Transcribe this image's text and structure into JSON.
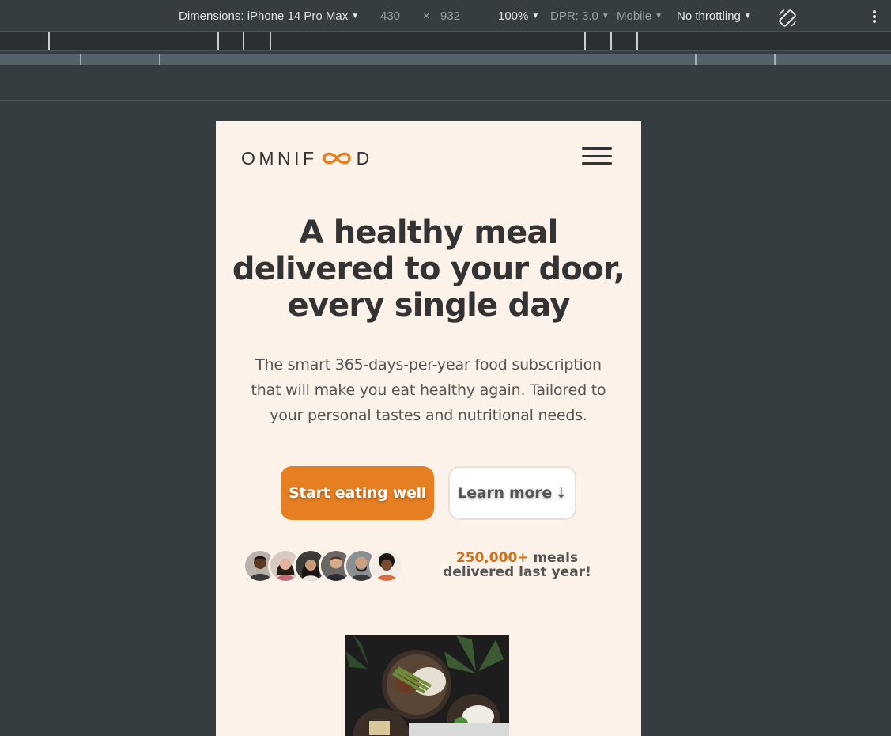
{
  "devtools": {
    "dimensions_label": "Dimensions: iPhone 14 Pro Max",
    "width": "430",
    "times": "×",
    "height": "932",
    "zoom": "100%",
    "dpr": "DPR: 3.0",
    "mode": "Mobile",
    "throttling": "No throttling",
    "caret": "▼"
  },
  "page": {
    "logo_text_left": "OMNIF",
    "logo_text_right": "D",
    "hero_title": "A healthy meal delivered to your door, every single day",
    "hero_text": "The smart 365-days-per-year food subscription that will make you eat healthy again. Tailored to your personal tastes and nutritional needs.",
    "cta_primary": "Start eating well",
    "cta_secondary": "Learn more",
    "cta_secondary_arrow": "↓",
    "delivered_count": "250,000+",
    "delivered_text": " meals delivered last year!"
  },
  "colors": {
    "accent": "#e67e22",
    "page_bg": "#fdf2e9",
    "text": "#333333",
    "devtools_bg": "#353d40"
  },
  "icons": [
    "rotate-icon",
    "more-vertical-icon",
    "menu-icon",
    "infinity-logo-icon"
  ]
}
